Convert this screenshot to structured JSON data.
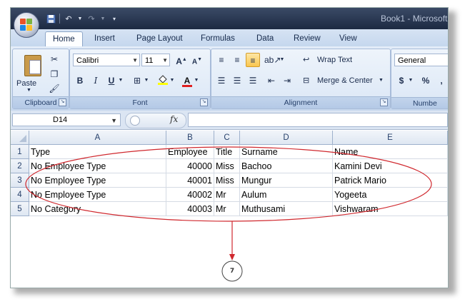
{
  "window": {
    "title": "Book1 - Microsoft"
  },
  "tabs": [
    {
      "label": "Home",
      "active": true
    },
    {
      "label": "Insert"
    },
    {
      "label": "Page Layout"
    },
    {
      "label": "Formulas"
    },
    {
      "label": "Data"
    },
    {
      "label": "Review"
    },
    {
      "label": "View"
    }
  ],
  "ribbon": {
    "clipboard": {
      "label": "Clipboard",
      "paste": "Paste"
    },
    "font": {
      "label": "Font",
      "name": "Calibri",
      "size": "11"
    },
    "alignment": {
      "label": "Alignment",
      "wrap_text": "Wrap Text",
      "merge_center": "Merge & Center"
    },
    "number": {
      "label": "Numbe",
      "format": "General",
      "currency": "$",
      "percent": "%"
    }
  },
  "formula_bar": {
    "name_box": "D14",
    "fx": "fx",
    "value": ""
  },
  "columns": [
    "A",
    "B",
    "C",
    "D",
    "E"
  ],
  "rows": [
    {
      "num": "1",
      "cells": [
        "Type",
        "Employee",
        "Title",
        "Surname",
        "Name"
      ]
    },
    {
      "num": "2",
      "cells": [
        "No Employee Type",
        "40000",
        "Miss",
        "Bachoo",
        "Kamini Devi"
      ]
    },
    {
      "num": "3",
      "cells": [
        "No Employee Type",
        "40001",
        "Miss",
        "Mungur",
        "Patrick Mario"
      ]
    },
    {
      "num": "4",
      "cells": [
        "No Employee Type",
        "40002",
        "Mr",
        "Aulum",
        "Yogeeta"
      ]
    },
    {
      "num": "5",
      "cells": [
        "No Category",
        "40003",
        "Mr",
        "Muthusami",
        "Vishwaram"
      ]
    }
  ],
  "annotation": {
    "label": "7",
    "color": "#d0282e"
  }
}
